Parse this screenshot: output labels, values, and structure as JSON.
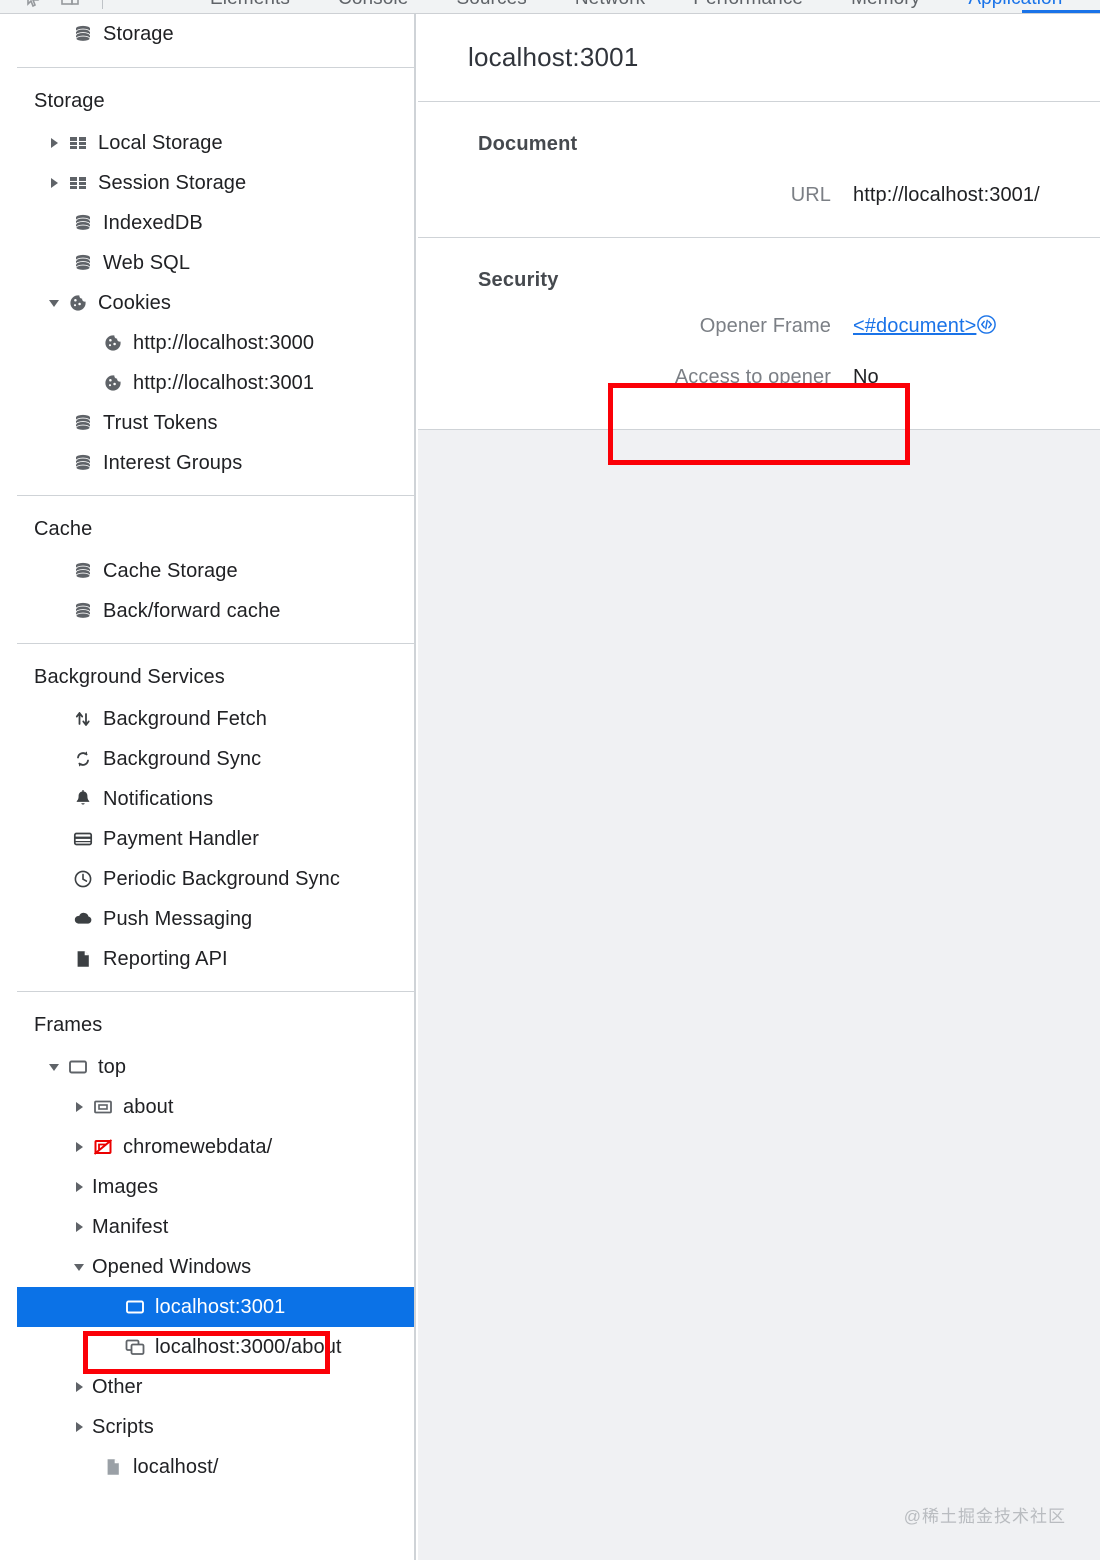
{
  "devtools": {
    "toolbar_icons": [
      "inspect-element-icon",
      "device-toolbar-icon"
    ],
    "tabs": [
      {
        "label": "Elements",
        "active": false
      },
      {
        "label": "Console",
        "active": false
      },
      {
        "label": "Sources",
        "active": false
      },
      {
        "label": "Network",
        "active": false
      },
      {
        "label": "Performance",
        "active": false
      },
      {
        "label": "Memory",
        "active": false
      },
      {
        "label": "Application",
        "active": true
      }
    ],
    "active_tab_color": "#1a73e8"
  },
  "sidebar": {
    "sections": [
      {
        "name": "partial-top",
        "header": null,
        "items": [
          {
            "label": "Storage",
            "icon": "database-icon",
            "indent": 2,
            "arrow": "none"
          }
        ]
      },
      {
        "name": "storage",
        "header": "Storage",
        "items": [
          {
            "label": "Local Storage",
            "icon": "table-icon",
            "indent": 1,
            "arrow": "right"
          },
          {
            "label": "Session Storage",
            "icon": "table-icon",
            "indent": 1,
            "arrow": "right"
          },
          {
            "label": "IndexedDB",
            "icon": "database-icon",
            "indent": 2,
            "arrow": "none"
          },
          {
            "label": "Web SQL",
            "icon": "database-icon",
            "indent": 2,
            "arrow": "none"
          },
          {
            "label": "Cookies",
            "icon": "cookie-icon",
            "indent": 1,
            "arrow": "down"
          },
          {
            "label": "http://localhost:3000",
            "icon": "cookie-icon",
            "indent": 3,
            "arrow": "none"
          },
          {
            "label": "http://localhost:3001",
            "icon": "cookie-icon",
            "indent": 3,
            "arrow": "none"
          },
          {
            "label": "Trust Tokens",
            "icon": "database-icon",
            "indent": 2,
            "arrow": "none"
          },
          {
            "label": "Interest Groups",
            "icon": "database-icon",
            "indent": 2,
            "arrow": "none"
          }
        ]
      },
      {
        "name": "cache",
        "header": "Cache",
        "items": [
          {
            "label": "Cache Storage",
            "icon": "database-icon",
            "indent": 2,
            "arrow": "none"
          },
          {
            "label": "Back/forward cache",
            "icon": "database-icon",
            "indent": 2,
            "arrow": "none"
          }
        ]
      },
      {
        "name": "background-services",
        "header": "Background Services",
        "items": [
          {
            "label": "Background Fetch",
            "icon": "arrows-updown-icon",
            "indent": 2,
            "arrow": "none"
          },
          {
            "label": "Background Sync",
            "icon": "sync-icon",
            "indent": 2,
            "arrow": "none"
          },
          {
            "label": "Notifications",
            "icon": "bell-icon",
            "indent": 2,
            "arrow": "none"
          },
          {
            "label": "Payment Handler",
            "icon": "credit-card-icon",
            "indent": 2,
            "arrow": "none"
          },
          {
            "label": "Periodic Background Sync",
            "icon": "clock-icon",
            "indent": 2,
            "arrow": "none"
          },
          {
            "label": "Push Messaging",
            "icon": "cloud-icon",
            "indent": 2,
            "arrow": "none"
          },
          {
            "label": "Reporting API",
            "icon": "document-icon",
            "indent": 2,
            "arrow": "none"
          }
        ]
      },
      {
        "name": "frames",
        "header": "Frames",
        "items": [
          {
            "label": "top",
            "icon": "frame-icon",
            "indent": 1,
            "arrow": "down",
            "selected": false
          },
          {
            "label": "about",
            "icon": "subframe-icon",
            "indent": 2,
            "arrow": "right",
            "selected": false
          },
          {
            "label": "chromewebdata/",
            "icon": "broken-frame-icon",
            "indent": 2,
            "arrow": "right",
            "selected": false
          },
          {
            "label": "Images",
            "icon": "none",
            "indent": 2,
            "arrow": "right",
            "selected": false
          },
          {
            "label": "Manifest",
            "icon": "none",
            "indent": 2,
            "arrow": "right",
            "selected": false
          },
          {
            "label": "Opened Windows",
            "icon": "none",
            "indent": 2,
            "arrow": "down",
            "selected": false
          },
          {
            "label": "localhost:3001",
            "icon": "window-icon",
            "indent": 4,
            "arrow": "none",
            "selected": true
          },
          {
            "label": "localhost:3000/about",
            "icon": "windows-stack-icon",
            "indent": 4,
            "arrow": "none",
            "selected": false
          },
          {
            "label": "Other",
            "icon": "none",
            "indent": 2,
            "arrow": "right",
            "selected": false
          },
          {
            "label": "Scripts",
            "icon": "none",
            "indent": 2,
            "arrow": "right",
            "selected": false
          },
          {
            "label": "localhost/",
            "icon": "document-icon",
            "indent": 3,
            "arrow": "none",
            "selected": false
          }
        ]
      }
    ],
    "selection_color": "#0b72e7"
  },
  "main": {
    "title": "localhost:3001",
    "sections": [
      {
        "heading": "Document",
        "rows": [
          {
            "key": "URL",
            "value": "http://localhost:3001/",
            "is_link": false
          }
        ]
      },
      {
        "heading": "Security",
        "rows": [
          {
            "key": "Opener Frame",
            "value": "<#document>",
            "is_link": true,
            "icon": "code-circle-icon"
          },
          {
            "key": "Access to opener",
            "value": "No",
            "is_link": false
          }
        ]
      }
    ]
  },
  "annotations": {
    "highlight_color": "#fb0007",
    "boxes": [
      {
        "name": "access-to-opener-highlight",
        "target": "Access to opener  No"
      },
      {
        "name": "selected-frame-highlight",
        "target": "localhost:3001"
      }
    ]
  },
  "watermark": "@稀土掘金技术社区"
}
